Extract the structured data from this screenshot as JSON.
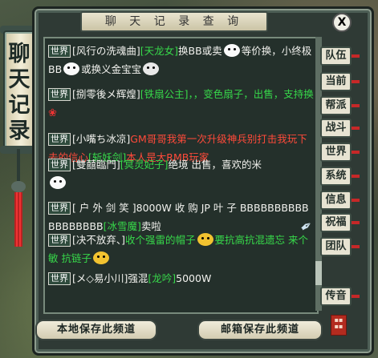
{
  "window": {
    "title": "聊 天 记 录 查 询",
    "side_banner": "聊天记录",
    "close_label": "X"
  },
  "channel_tag": "世界",
  "messages": [
    {
      "sender": "[风行の洗魂曲]",
      "mention": "[天龙女]",
      "text1": "换BB或卖",
      "text2": "等价换，小终极BB",
      "text3": "或换义金宝宝"
    },
    {
      "sender": "[捌零後メ辉煌]",
      "mention": "[铁扇公主]",
      "text1": "，，变色扇子，出售，支持换"
    },
    {
      "sender": "[小嘴ち冰凉]",
      "text1": "GM哥哥我第一次升级神兵别打击我玩下去的信心",
      "mention": "[斩妖剑]",
      "text2": "本人是大RMB玩家"
    },
    {
      "sender": "[雙囍臨門]",
      "mention": "[冥灵妃子]",
      "text1": "绝境 出售，喜欢的米"
    },
    {
      "sender": "[ 户 外 剑 笑 ]",
      "text1": "8000W 收 购 JP 叶 子 BBBBBBBBBBBBBBBBBB",
      "mention": "[冰雪魔]",
      "text2": "卖啦"
    },
    {
      "sender": "[决不放弃、]",
      "text1": "收个强雷的帽子",
      "text2": "要抗高抗混遗忘 来个敏 抗链子"
    },
    {
      "sender": "[メ◇易小川]",
      "text1": "强混",
      "mention": "[龙吟]",
      "text2": "5000W"
    }
  ],
  "channels": [
    "队伍",
    "当前",
    "帮派",
    "战斗",
    "世界",
    "系统",
    "信息",
    "祝福",
    "团队",
    "传音"
  ],
  "buttons": {
    "local_save": "本地保存此频道",
    "mail_save": "邮箱保存此频道"
  },
  "icons": {
    "close": "close-icon",
    "emote": "emoticon-icon",
    "rose": "rose-icon",
    "pen": "quill-icon"
  }
}
